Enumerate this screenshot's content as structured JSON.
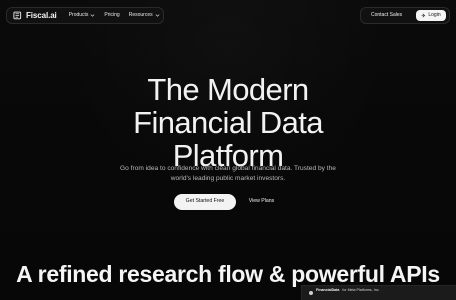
{
  "brand": {
    "name": "Fiscal.ai",
    "logo_icon": "ledger-icon"
  },
  "nav": {
    "items": [
      {
        "label": "Products",
        "icon": "chevron-down-icon"
      },
      {
        "label": "Pricing"
      },
      {
        "label": "Resources",
        "icon": "chevron-down-icon"
      }
    ]
  },
  "actions": {
    "contact_label": "Contact Sales",
    "login_label": "Login",
    "login_icon": "login-icon"
  },
  "hero": {
    "title_lines": [
      "The Modern",
      "Financial Data",
      "Platform"
    ],
    "subtitle_lines": [
      "Go from idea to confidence with clean global financial data. Trusted by the",
      "world's leading public market investors."
    ],
    "primary_cta": "Get Started Free",
    "secondary_cta": "View Plans"
  },
  "section": {
    "heading": "A refined research flow & powerful APIs"
  },
  "preview": {
    "brand": "FinancialData",
    "text": "for Meta Platforms, Inc."
  },
  "colors": {
    "background": "#080808",
    "surface": "#111111",
    "border": "#2a2a2a",
    "text": "#f3f3f3",
    "muted_text": "#b9b9b9",
    "button_light": "#f3f3f3"
  }
}
